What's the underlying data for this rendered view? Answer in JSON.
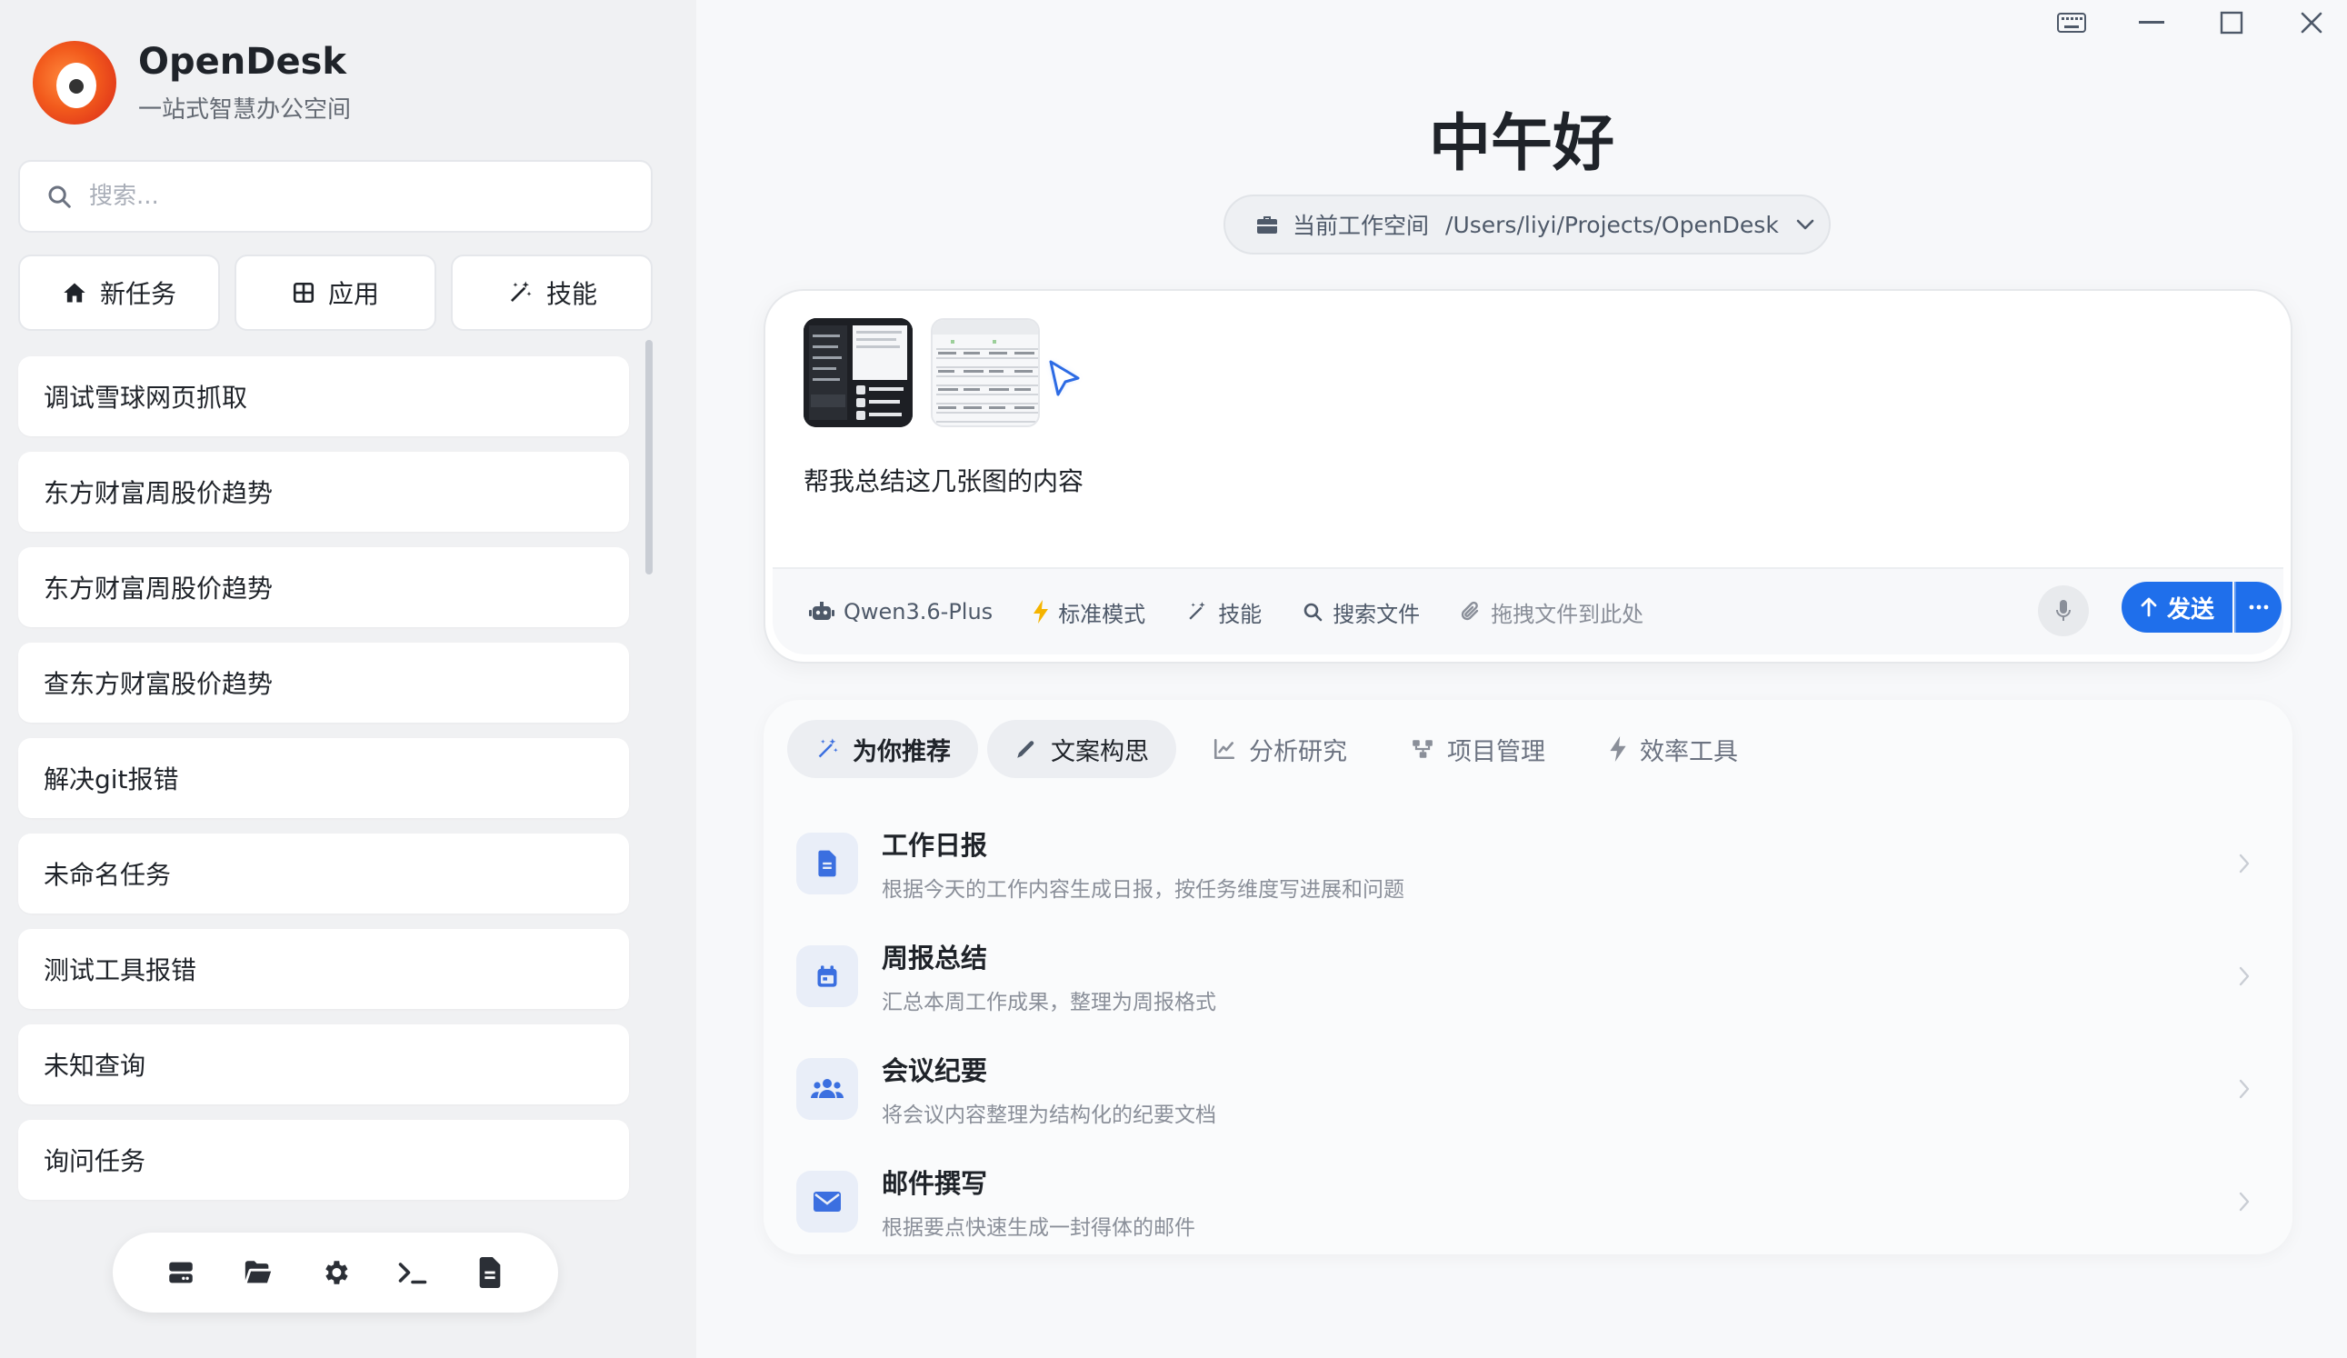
{
  "app": {
    "name": "OpenDesk",
    "subtitle": "一站式智慧办公空间"
  },
  "sidebar": {
    "search_placeholder": "搜索...",
    "quick_actions": [
      {
        "label": "新任务",
        "icon": "home-icon"
      },
      {
        "label": "应用",
        "icon": "grid-icon"
      },
      {
        "label": "技能",
        "icon": "magic-wand-icon"
      }
    ],
    "tasks": [
      {
        "label": "调试雪球网页抓取"
      },
      {
        "label": "东方财富周股价趋势"
      },
      {
        "label": "东方财富周股价趋势"
      },
      {
        "label": "查东方财富股价趋势"
      },
      {
        "label": "解决git报错"
      },
      {
        "label": "未命名任务"
      },
      {
        "label": "测试工具报错"
      },
      {
        "label": "未知查询"
      },
      {
        "label": "询问任务"
      }
    ],
    "dock": [
      "server-icon",
      "folder-open-icon",
      "gear-icon",
      "terminal-icon",
      "file-icon"
    ]
  },
  "window_controls": [
    "keyboard-icon",
    "minimize-icon",
    "maximize-icon",
    "close-icon"
  ],
  "main": {
    "greeting": "中午好",
    "workspace": {
      "label": "当前工作空间",
      "path": "/Users/liyi/Projects/OpenDesk"
    },
    "composer": {
      "prompt_text": "帮我总结这几张图的内容",
      "attachments": [
        "screenshot-thumbnail-dark",
        "screenshot-thumbnail-table"
      ],
      "toolbar": {
        "model": "Qwen3.6-Plus",
        "mode": "标准模式",
        "skills": "技能",
        "search_files": "搜索文件",
        "drop_hint": "拖拽文件到此处"
      },
      "send_label": "发送"
    },
    "recommend": {
      "tabs": [
        {
          "label": "为你推荐",
          "icon": "magic-wand-icon"
        },
        {
          "label": "文案构思",
          "icon": "pen-icon"
        },
        {
          "label": "分析研究",
          "icon": "line-chart-icon"
        },
        {
          "label": "项目管理",
          "icon": "nodes-icon"
        },
        {
          "label": "效率工具",
          "icon": "bolt-icon"
        }
      ],
      "active_tab": "为你推荐",
      "items": [
        {
          "title": "工作日报",
          "desc": "根据今天的工作内容生成日报，按任务维度写进展和问题",
          "icon": "document-icon"
        },
        {
          "title": "周报总结",
          "desc": "汇总本周工作成果，整理为周报格式",
          "icon": "calendar-icon"
        },
        {
          "title": "会议纪要",
          "desc": "将会议内容整理为结构化的纪要文档",
          "icon": "users-icon"
        },
        {
          "title": "邮件撰写",
          "desc": "根据要点快速生成一封得体的邮件",
          "icon": "envelope-icon"
        }
      ]
    }
  },
  "colors": {
    "accent": "#1f6feb",
    "sidebar_bg": "#f0f1f3",
    "main_bg": "#f7f8fa",
    "icon_blue": "#3b6fe0"
  }
}
